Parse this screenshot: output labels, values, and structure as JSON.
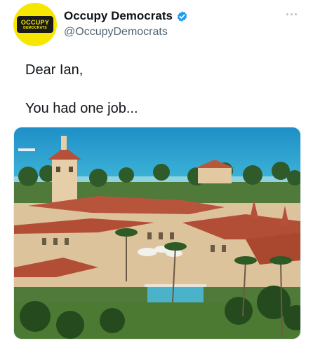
{
  "account": {
    "display_name": "Occupy Democrats",
    "handle": "@OccupyDemocrats",
    "verified": true,
    "avatar": {
      "logo_top": "OCCUPY",
      "logo_bottom": "DEMOCRATS",
      "background": "#f7e600"
    }
  },
  "tweet": {
    "lines": [
      "Dear Ian,",
      "You had one job..."
    ]
  },
  "icons": {
    "verified": "verified-badge-icon",
    "more": "more-options-icon"
  },
  "colors": {
    "verified_blue": "#1d9bf0",
    "handle_gray": "#536471",
    "text": "#0f1419"
  }
}
